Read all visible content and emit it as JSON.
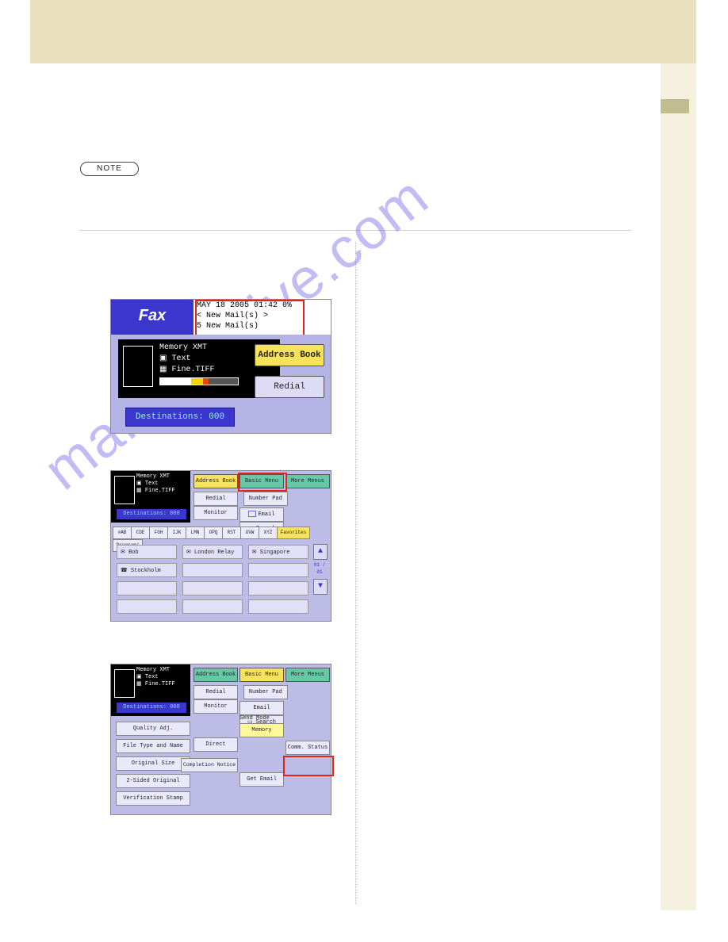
{
  "note_label": "NOTE",
  "watermark": "manualshive.com",
  "shot1": {
    "title": "Fax",
    "date_line": "MAY 18 2005  01:42   0%",
    "mail_line1": "< New Mail(s) >",
    "mail_line2": "  5 New Mail(s)",
    "memory": "Memory XMT",
    "text_mode": "Text",
    "resolution": "Fine.TIFF",
    "addr_book": "Address Book",
    "redial": "Redial",
    "destinations": "Destinations: 000"
  },
  "shared_left": {
    "memory": "Memory XMT",
    "text_mode": "Text",
    "resolution": "Fine.TIFF",
    "destinations": "Destinations: 000"
  },
  "tabs": {
    "addr": "Address Book",
    "basic": "Basic Menu",
    "more": "More Menus"
  },
  "midbtns": {
    "redial": "Redial",
    "numpad": "Number Pad",
    "monitor": "Monitor",
    "email": "Email",
    "search": "Search"
  },
  "alpharow": [
    "#AB",
    "CDE",
    "FGH",
    "IJK",
    "LMN",
    "OPQ",
    "RST",
    "UVW",
    "XYZ"
  ],
  "alpha_fav": "Favorites",
  "alpha_pg": "Program/\nGroup",
  "entries": [
    "Bob",
    "London Relay",
    "Singapore Relay",
    "Stockholm",
    "",
    "",
    "",
    "",
    "",
    "",
    "",
    ""
  ],
  "arrow_page": "01\n/\n01",
  "shot3": {
    "sendmode_label": "Send Mode",
    "memory": "Memory",
    "direct": "Direct",
    "comm": "Comm. Status",
    "completion": "Completion Notice",
    "get_email": "Get Email",
    "left_buttons": [
      "Quality Adj.",
      "File Type and Name",
      "Original Size",
      "2-Sided Original",
      "Verification Stamp"
    ]
  }
}
